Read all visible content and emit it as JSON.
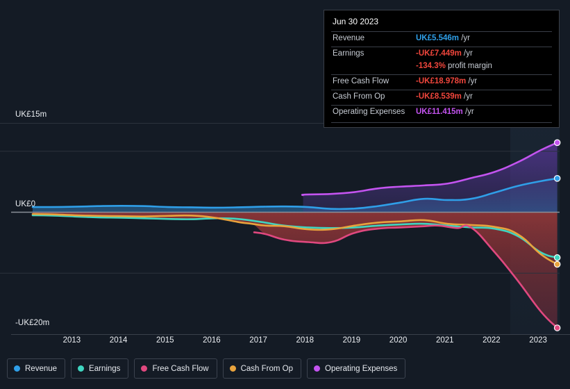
{
  "chart_data": {
    "type": "line",
    "title": "",
    "xlabel": "",
    "ylabel": "",
    "currency": "UK£",
    "ylim": [
      -20,
      15
    ],
    "y_ticks": [
      {
        "value": 15,
        "label": "UK£15m"
      },
      {
        "value": 0,
        "label": "UK£0"
      },
      {
        "value": -20,
        "label": "-UK£20m"
      }
    ],
    "gridlines": [
      10,
      0,
      -10
    ],
    "grid": true,
    "legend_position": "bottom",
    "x_ticks": [
      "2013",
      "2014",
      "2015",
      "2016",
      "2017",
      "2018",
      "2019",
      "2020",
      "2021",
      "2022",
      "2023"
    ],
    "x_range": [
      2012.6,
      2023.9
    ],
    "forecast_start": "2022.2",
    "series": [
      {
        "name": "Revenue",
        "color": "#2f9fe8",
        "x": [
          2012.6,
          2013.0,
          2013.5,
          2014.0,
          2014.5,
          2015.0,
          2015.5,
          2016.0,
          2016.5,
          2017.0,
          2017.5,
          2018.0,
          2018.5,
          2019.0,
          2019.5,
          2020.0,
          2020.5,
          2021.0,
          2021.5,
          2022.0,
          2022.5,
          2023.0,
          2023.5,
          2023.85
        ],
        "y": [
          0.85,
          0.85,
          0.9,
          1.0,
          1.05,
          1.0,
          0.85,
          0.8,
          0.75,
          0.8,
          0.9,
          0.95,
          0.85,
          0.55,
          0.6,
          1.0,
          1.6,
          2.2,
          2.0,
          2.2,
          3.2,
          4.3,
          5.1,
          5.546
        ]
      },
      {
        "name": "Earnings",
        "color": "#3fd5c0",
        "x": [
          2012.6,
          2013.0,
          2013.5,
          2014.0,
          2014.5,
          2015.0,
          2015.5,
          2016.0,
          2016.5,
          2017.0,
          2017.5,
          2018.0,
          2018.5,
          2019.0,
          2019.5,
          2020.0,
          2020.5,
          2021.0,
          2021.5,
          2022.0,
          2022.5,
          2023.0,
          2023.5,
          2023.85
        ],
        "y": [
          -0.5,
          -0.55,
          -0.7,
          -0.85,
          -0.9,
          -1.0,
          -1.1,
          -1.15,
          -1.0,
          -1.1,
          -1.6,
          -2.2,
          -2.5,
          -2.6,
          -2.5,
          -2.2,
          -2.0,
          -1.9,
          -2.2,
          -2.5,
          -2.7,
          -3.9,
          -6.6,
          -7.449
        ]
      },
      {
        "name": "Free Cash Flow",
        "color": "#e0487f",
        "x": [
          2017.35,
          2017.6,
          2018.0,
          2018.5,
          2019.0,
          2019.5,
          2020.0,
          2020.5,
          2021.0,
          2021.3,
          2021.7,
          2022.0,
          2022.5,
          2023.0,
          2023.5,
          2023.85
        ],
        "y": [
          -3.3,
          -3.6,
          -4.5,
          -4.9,
          -4.9,
          -3.4,
          -2.7,
          -2.5,
          -2.3,
          -2.2,
          -2.6,
          -2.5,
          -6.5,
          -11.2,
          -16.3,
          -18.978
        ]
      },
      {
        "name": "Cash From Op",
        "color": "#e8a košice",
        "y_note": "",
        "x": [
          2012.6,
          2013.0,
          2013.5,
          2014.0,
          2014.5,
          2015.0,
          2015.5,
          2016.0,
          2016.5,
          2017.0,
          2017.3,
          2017.6,
          2018.0,
          2018.5,
          2019.0,
          2019.5,
          2020.0,
          2020.5,
          2021.0,
          2021.5,
          2022.0,
          2022.5,
          2023.0,
          2023.5,
          2023.85
        ],
        "y": [
          -0.3,
          -0.35,
          -0.5,
          -0.6,
          -0.65,
          -0.7,
          -0.6,
          -0.55,
          -0.9,
          -1.6,
          -1.9,
          -2.2,
          -2.3,
          -2.8,
          -2.8,
          -2.2,
          -1.7,
          -1.5,
          -1.3,
          -1.9,
          -2.1,
          -2.4,
          -3.6,
          -6.9,
          -8.539
        ]
      },
      {
        "name": "Operating Expenses",
        "color": "#c454f0",
        "x": [
          2018.4,
          2018.45,
          2019.0,
          2019.5,
          2020.0,
          2020.5,
          2021.0,
          2021.5,
          2022.0,
          2022.5,
          2023.0,
          2023.5,
          2023.85
        ],
        "y": [
          2.8,
          2.9,
          3.0,
          3.3,
          3.9,
          4.2,
          4.4,
          4.7,
          5.6,
          6.6,
          8.2,
          10.2,
          11.415
        ]
      }
    ],
    "endpoint_markers": [
      {
        "series": "Operating Expenses",
        "value": 11.415
      },
      {
        "series": "Revenue",
        "value": 5.546
      },
      {
        "series": "Earnings",
        "value": -7.449
      },
      {
        "series": "Cash From Op",
        "value": -8.539
      },
      {
        "series": "Free Cash Flow",
        "value": -18.978
      }
    ]
  },
  "tooltip": {
    "date": "Jun 30 2023",
    "rows": [
      {
        "label": "Revenue",
        "value": "UK£5.546m",
        "unit": "/yr",
        "color": "#2f9fe8"
      },
      {
        "label": "Earnings",
        "value": "-UK£7.449m",
        "unit": "/yr",
        "color": "#f0463c"
      },
      {
        "label": "",
        "value": "-134.3%",
        "unit": "profit margin",
        "color": "#f0463c"
      },
      {
        "label": "Free Cash Flow",
        "value": "-UK£18.978m",
        "unit": "/yr",
        "color": "#f0463c"
      },
      {
        "label": "Cash From Op",
        "value": "-UK£8.539m",
        "unit": "/yr",
        "color": "#f0463c"
      },
      {
        "label": "Operating Expenses",
        "value": "UK£11.415m",
        "unit": "/yr",
        "color": "#c454f0"
      }
    ]
  },
  "legend": {
    "items": [
      {
        "label": "Revenue",
        "color": "#2f9fe8"
      },
      {
        "label": "Earnings",
        "color": "#3fd5c0"
      },
      {
        "label": "Free Cash Flow",
        "color": "#e0487f"
      },
      {
        "label": "Cash From Op",
        "color": "#e8a33d"
      },
      {
        "label": "Operating Expenses",
        "color": "#c454f0"
      }
    ]
  },
  "colors": {
    "background": "#141b25",
    "plot_background": "#141b25",
    "gridline": "#2b323d",
    "zero_line": "#8a9099",
    "positive_fill": "#2e4f78",
    "negative_fill": "#8d3237",
    "forecast_band": "#1b2836",
    "axis_text": "#eceff3"
  }
}
